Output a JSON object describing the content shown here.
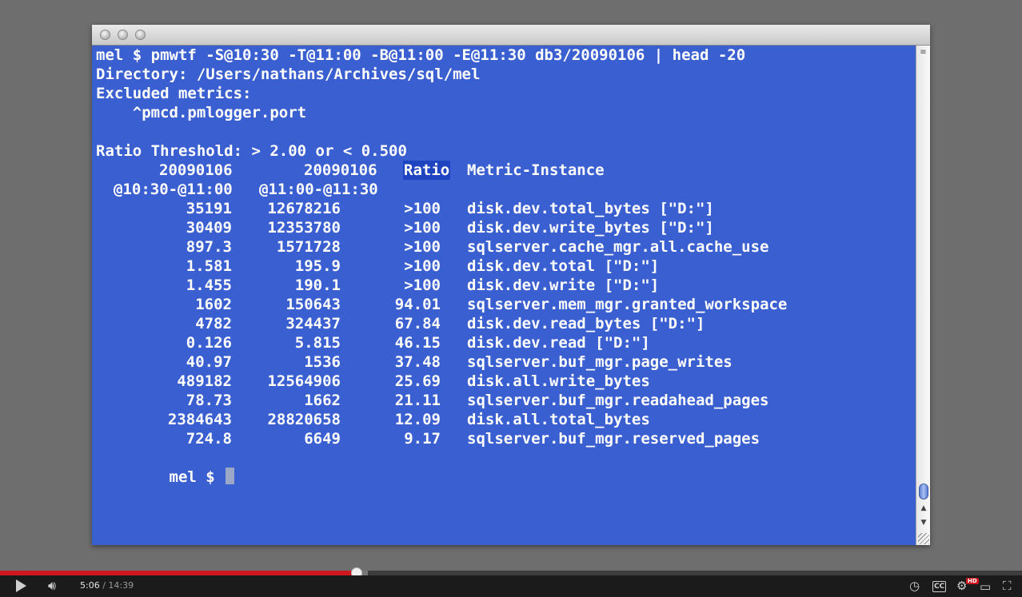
{
  "terminal": {
    "command_line": "mel $ pmwtf -S@10:30 -T@11:00 -B@11:00 -E@11:30 db3/20090106 | head -20",
    "directory_line": "Directory: /Users/nathans/Archives/sql/mel",
    "excluded_label": "Excluded metrics:",
    "excluded_metric": "    ^pmcd.pmlogger.port",
    "ratio_threshold": "Ratio Threshold: > 2.00 or < 0.500",
    "header": {
      "col1_date": "20090106",
      "col2_date": "20090106",
      "ratio": "Ratio",
      "metric": "Metric-Instance",
      "col1_range": "@10:30-@11:00",
      "col2_range": "@11:00-@11:30"
    },
    "rows": [
      {
        "a": "35191",
        "b": "12678216",
        "ratio": ">100",
        "metric": "disk.dev.total_bytes [\"D:\"]"
      },
      {
        "a": "30409",
        "b": "12353780",
        "ratio": ">100",
        "metric": "disk.dev.write_bytes [\"D:\"]"
      },
      {
        "a": "897.3",
        "b": "1571728",
        "ratio": ">100",
        "metric": "sqlserver.cache_mgr.all.cache_use"
      },
      {
        "a": "1.581",
        "b": "195.9",
        "ratio": ">100",
        "metric": "disk.dev.total [\"D:\"]"
      },
      {
        "a": "1.455",
        "b": "190.1",
        "ratio": ">100",
        "metric": "disk.dev.write [\"D:\"]"
      },
      {
        "a": "1602",
        "b": "150643",
        "ratio": "94.01",
        "metric": "sqlserver.mem_mgr.granted_workspace"
      },
      {
        "a": "4782",
        "b": "324437",
        "ratio": "67.84",
        "metric": "disk.dev.read_bytes [\"D:\"]"
      },
      {
        "a": "0.126",
        "b": "5.815",
        "ratio": "46.15",
        "metric": "disk.dev.read [\"D:\"]"
      },
      {
        "a": "40.97",
        "b": "1536",
        "ratio": "37.48",
        "metric": "sqlserver.buf_mgr.page_writes"
      },
      {
        "a": "489182",
        "b": "12564906",
        "ratio": "25.69",
        "metric": "disk.all.write_bytes"
      },
      {
        "a": "78.73",
        "b": "1662",
        "ratio": "21.11",
        "metric": "sqlserver.buf_mgr.readahead_pages"
      },
      {
        "a": "2384643",
        "b": "28820658",
        "ratio": "12.09",
        "metric": "disk.all.total_bytes"
      },
      {
        "a": "724.8",
        "b": "6649",
        "ratio": "9.17",
        "metric": "sqlserver.buf_mgr.reserved_pages"
      }
    ],
    "prompt": "mel $ "
  },
  "player": {
    "current_time": "5:06",
    "separator": " / ",
    "duration": "14:39",
    "progress_fraction": 0.349,
    "buffered_fraction": 0.36,
    "hd_badge": "HD",
    "cc_label": "CC",
    "accent_color": "#cc181e"
  }
}
